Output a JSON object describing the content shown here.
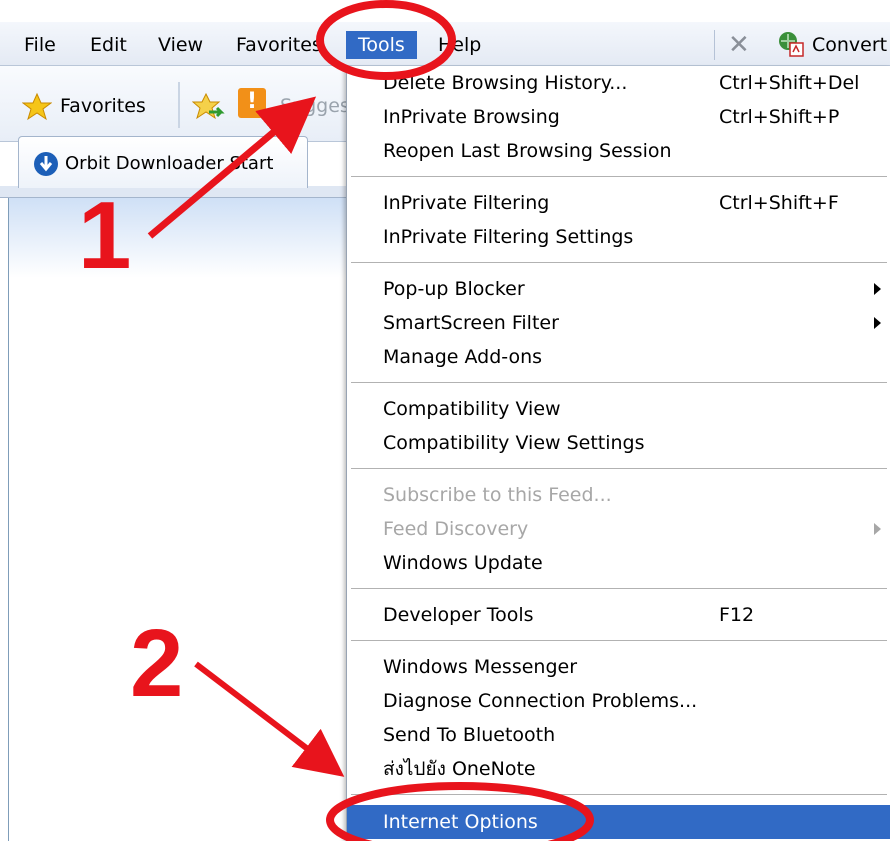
{
  "menubar": {
    "items": [
      "File",
      "Edit",
      "View",
      "Favorites",
      "Tools",
      "Help"
    ],
    "active": "Tools",
    "convert_label": "Convert"
  },
  "favbar": {
    "favorites_label": "Favorites",
    "suggested_label": "Sugges"
  },
  "tab": {
    "title": "Orbit Downloader Start"
  },
  "tools_menu": {
    "items": [
      {
        "label": "Delete Browsing History...",
        "shortcut": "Ctrl+Shift+Del"
      },
      {
        "label": "InPrivate Browsing",
        "shortcut": "Ctrl+Shift+P"
      },
      {
        "label": "Reopen Last Browsing Session",
        "shortcut": ""
      },
      {
        "label": "InPrivate Filtering",
        "shortcut": "Ctrl+Shift+F"
      },
      {
        "label": "InPrivate Filtering Settings",
        "shortcut": ""
      },
      {
        "label": "Pop-up Blocker",
        "shortcut": "",
        "submenu": true
      },
      {
        "label": "SmartScreen Filter",
        "shortcut": "",
        "submenu": true
      },
      {
        "label": "Manage Add-ons",
        "shortcut": ""
      },
      {
        "label": "Compatibility View",
        "shortcut": ""
      },
      {
        "label": "Compatibility View Settings",
        "shortcut": ""
      },
      {
        "label": "Subscribe to this Feed...",
        "shortcut": "",
        "disabled": true
      },
      {
        "label": "Feed Discovery",
        "shortcut": "",
        "disabled": true,
        "submenu": true
      },
      {
        "label": "Windows Update",
        "shortcut": ""
      },
      {
        "label": "Developer Tools",
        "shortcut": "F12"
      },
      {
        "label": "Windows Messenger",
        "shortcut": ""
      },
      {
        "label": "Diagnose Connection Problems...",
        "shortcut": ""
      },
      {
        "label": "Send To Bluetooth",
        "shortcut": ""
      },
      {
        "label": "ส่งไปยัง OneNote",
        "shortcut": ""
      },
      {
        "label": "Internet Options",
        "shortcut": "",
        "highlighted": true
      }
    ]
  },
  "annotations": {
    "step1": "1",
    "step2": "2",
    "color": "#e8141c"
  },
  "colors": {
    "menu_highlight": "#316ac5",
    "annotation_red": "#e8141c"
  }
}
